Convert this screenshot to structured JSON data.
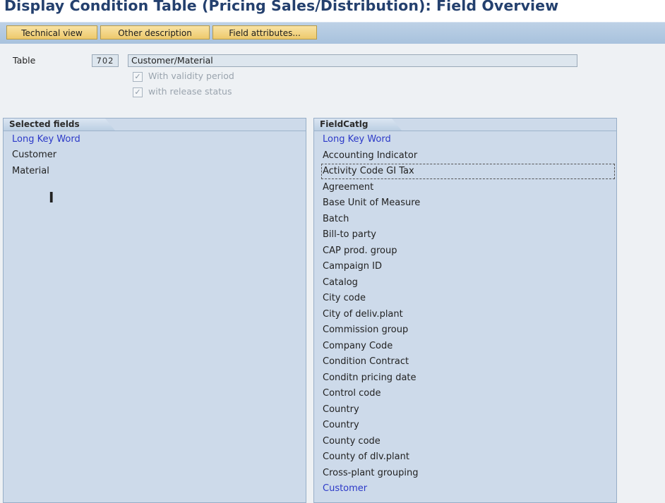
{
  "title": "Display Condition Table (Pricing Sales/Distribution): Field Overview",
  "toolbar": {
    "buttons": [
      "Technical view",
      "Other description",
      "Field attributes..."
    ]
  },
  "form": {
    "table_label": "Table",
    "table_number": "702",
    "table_description": "Customer/Material",
    "with_validity_period": {
      "label": "With validity period",
      "checked": true
    },
    "with_release_status": {
      "label": "with release status",
      "checked": true
    }
  },
  "selected_fields": {
    "header": "Selected fields",
    "items": [
      "Long Key Word",
      "Customer",
      "Material"
    ]
  },
  "field_catalog": {
    "header": "FieldCatlg",
    "items": [
      "Long Key Word",
      "Accounting Indicator",
      "Activity Code GI Tax",
      "Agreement",
      "Base Unit of Measure",
      "Batch",
      "Bill-to party",
      "CAP prod. group",
      "Campaign ID",
      "Catalog",
      "City code",
      "City of deliv.plant",
      "Commission group",
      "Company Code",
      "Condition Contract",
      "Conditn pricing date",
      "Control code",
      "Country",
      "Country",
      "County code",
      "County of dlv.plant",
      "Cross-plant grouping",
      "Customer"
    ]
  },
  "colors": {
    "title": "#24406e",
    "heading_link": "#2c39c8",
    "panel_bg": "#cddaea",
    "button_bg": "#edc96c"
  }
}
